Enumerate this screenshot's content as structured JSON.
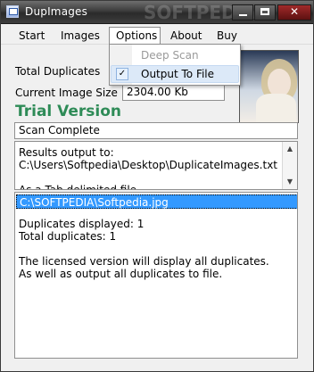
{
  "window": {
    "title": "DupImages",
    "title_watermark": "SOFTPEDIA"
  },
  "titlebar": {
    "minimize_symbol": "",
    "maximize_symbol": "",
    "close_symbol": "✕"
  },
  "menu": {
    "start": "Start",
    "images": "Images",
    "options": "Options",
    "about": "About",
    "buy": "Buy"
  },
  "options_menu": {
    "deep_scan": "Deep Scan",
    "output_to_file": "Output To File",
    "output_checked": true,
    "check_symbol": "✓"
  },
  "labels": {
    "total_duplicates": "Total Duplicates",
    "current_image_size": "Current Image Size"
  },
  "current_image_size_value": "2304.00 Kb",
  "trial_version": "Trial Version",
  "status": "Scan Complete",
  "results": {
    "text": "Results output to:\nC:\\Users\\Softpedia\\Desktop\\DuplicateImages.txt\n\nAs a Tab delimited file",
    "scroll_up_glyph": "▲",
    "scroll_down_glyph": "▼"
  },
  "duplicates_list": {
    "selected_item": "C:\\SOFTPEDIA\\Softpedia.jpg",
    "body": "Duplicates displayed: 1\nTotal duplicates: 1\n\nThe licensed version will display all duplicates.\nAs well as output all duplicates to file."
  },
  "colors": {
    "trial_green": "#2e8b57",
    "selection_blue": "#3399ff",
    "menu_highlight": "#dce9f8"
  }
}
